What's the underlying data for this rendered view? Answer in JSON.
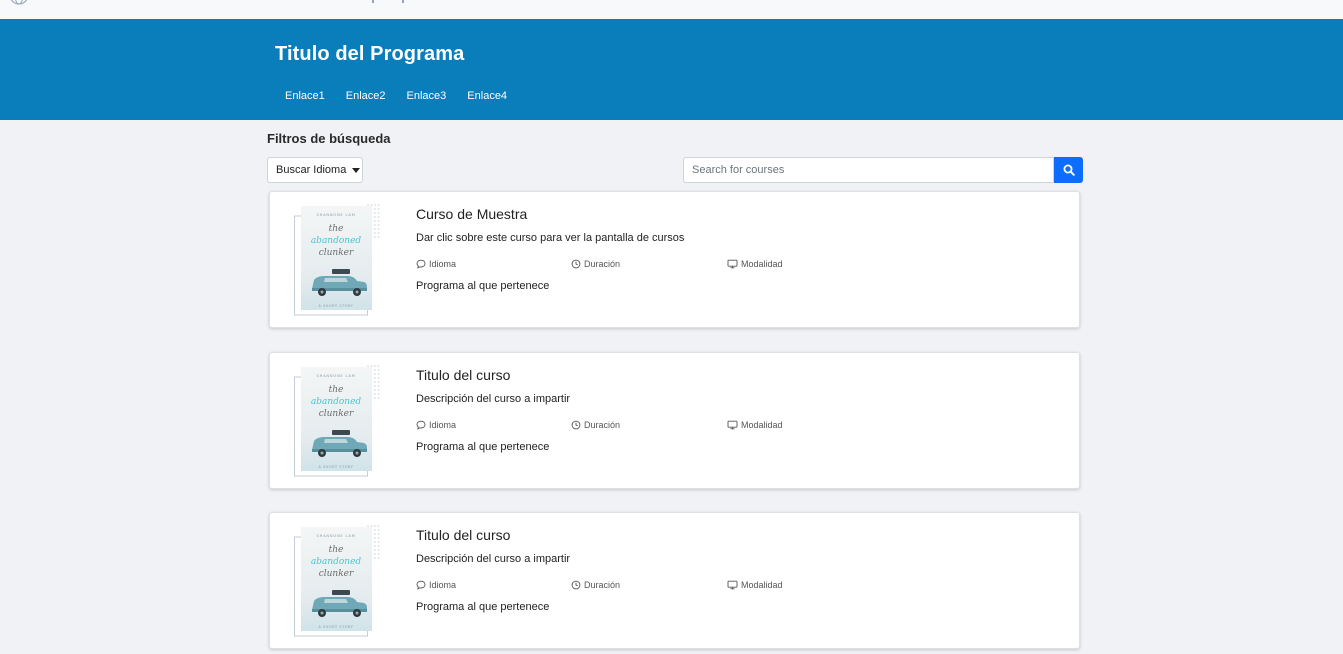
{
  "header": {
    "title": "Titulo del Programa",
    "nav": [
      "Enlace1",
      "Enlace2",
      "Enlace3",
      "Enlace4"
    ]
  },
  "filters": {
    "title": "Filtros de búsqueda",
    "language_button": "Buscar Idioma",
    "search_placeholder": "Search for courses"
  },
  "cover": {
    "author": "SHANNONE LAM",
    "line1": "the",
    "line2": "abandoned",
    "line3": "clunker",
    "footer": "A SHORT STORY"
  },
  "courses": [
    {
      "title": "Curso de Muestra",
      "description": "Dar clic sobre este curso para ver la pantalla de cursos",
      "language": "Idioma",
      "duration": "Duración",
      "modality": "Modalidad",
      "program": "Programa al que pertenece"
    },
    {
      "title": "Titulo del curso",
      "description": "Descripción del curso a impartir",
      "language": "Idioma",
      "duration": "Duración",
      "modality": "Modalidad",
      "program": "Programa al que pertenece"
    },
    {
      "title": "Titulo del curso",
      "description": "Descripción del curso a impartir",
      "language": "Idioma",
      "duration": "Duración",
      "modality": "Modalidad",
      "program": "Programa al que pertenece"
    }
  ],
  "icons": {
    "language": "chat-bubble-icon",
    "duration": "clock-icon",
    "modality": "monitor-icon",
    "search": "search-icon"
  },
  "colors": {
    "banner": "#0a7dbb",
    "search_button": "#0d6efd",
    "background": "#f0f2f6"
  }
}
